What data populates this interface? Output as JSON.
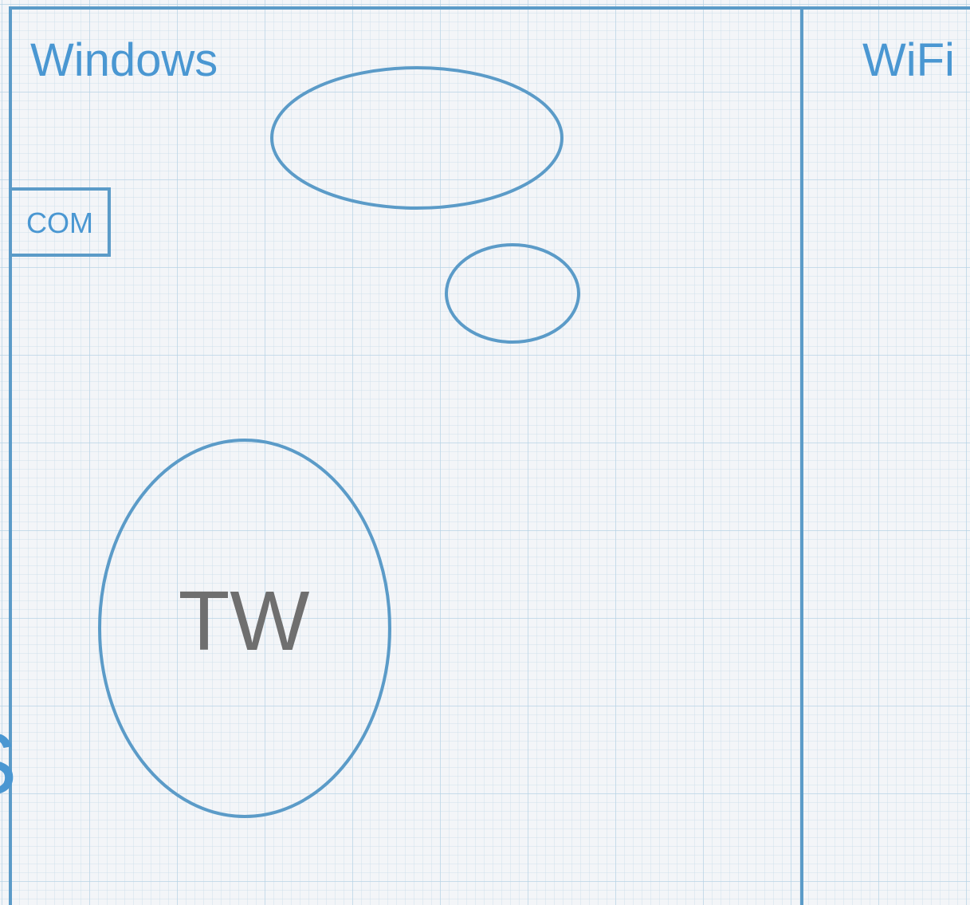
{
  "diagram": {
    "zones": [
      {
        "label": "Windows"
      },
      {
        "label": "WiFi"
      }
    ],
    "port_label": "COM",
    "node_label": "TW",
    "edge_fragment": "S"
  },
  "colors": {
    "stroke": "#5b9bc8",
    "label_blue": "#4a97d2",
    "node_text": "#6f6f6f",
    "grid": "#b2d0e4",
    "background": "#f3f5f8"
  }
}
